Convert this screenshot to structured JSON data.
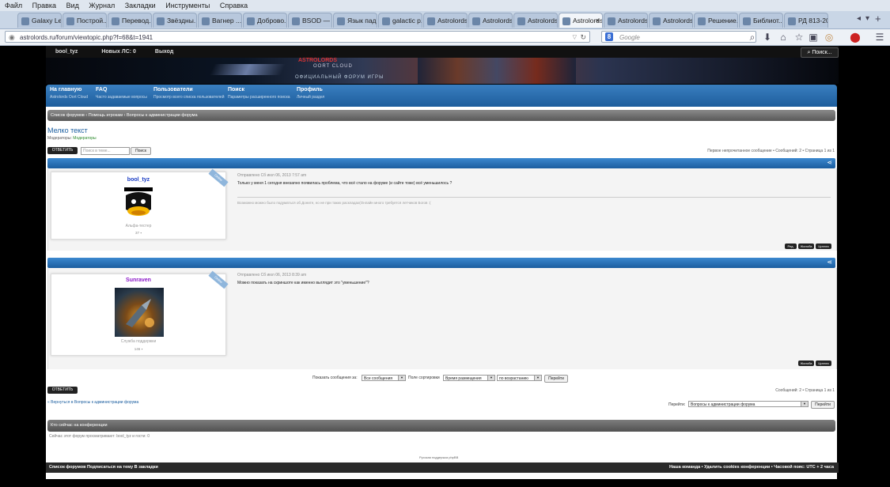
{
  "browser": {
    "menu": [
      "Файл",
      "Правка",
      "Вид",
      "Журнал",
      "Закладки",
      "Инструменты",
      "Справка"
    ],
    "tabs": [
      {
        "label": "Galaxy Le..."
      },
      {
        "label": "Построй..."
      },
      {
        "label": "Перевод..."
      },
      {
        "label": "Звёздны..."
      },
      {
        "label": "Вагнер ..."
      },
      {
        "label": "Доброво..."
      },
      {
        "label": "BSOD — ..."
      },
      {
        "label": "Язык пад..."
      },
      {
        "label": "galactic p..."
      },
      {
        "label": "Astrolords - C..."
      },
      {
        "label": "Astrolords Оо..."
      },
      {
        "label": "Astrolords Оо..."
      },
      {
        "label": "Astrolords Оо...",
        "active": true
      },
      {
        "label": "Astrolords Оо..."
      },
      {
        "label": "Astrolords Оо..."
      },
      {
        "label": "Решение..."
      },
      {
        "label": "Библиот..."
      },
      {
        "label": "РД 813-2013..."
      }
    ],
    "url": "astrolords.ru/forum/viewtopic.php?f=68&t=1941",
    "search_placeholder": "Google"
  },
  "forum": {
    "topbar": {
      "user": "bool_tyz",
      "messages": "Новых ЛС: 0",
      "logout": "Выход",
      "search": "Поиск..."
    },
    "banner": {
      "title": "ASTROLORDS",
      "sub1": "OORT CLOUD",
      "sub2": "ОФИЦИАЛЬНЫЙ ФОРУМ ИГРЫ"
    },
    "nav": [
      {
        "title": "На главную",
        "desc": "Astrolords Oort Cloud"
      },
      {
        "title": "FAQ",
        "desc": "Часто задаваемые вопросы"
      },
      {
        "title": "Пользователи",
        "desc": "Просмотр всего списка пользователей"
      },
      {
        "title": "Поиск",
        "desc": "Параметры расширенного поиска"
      },
      {
        "title": "Профиль",
        "desc": "Личный раздел"
      }
    ],
    "breadcrumb": "Список форумов ‹ Помощь игрокам ‹ Вопросы к администрации форума",
    "topic_title": "Мелко текст",
    "moderators_label": "Модераторы:",
    "moderators_value": "Модераторы",
    "reply_label": "ОТВЕТИТЬ",
    "search_topic_placeholder": "Поиск в теме...",
    "search_btn": "Поиск",
    "pagination_top": "Первое непрочитанное сообщение • Сообщений: 2 • Страница 1 из 1",
    "pagination_bottom": "Сообщений: 2 • Страница 1 из 1",
    "posts": [
      {
        "author": "bool_tyz",
        "author_color": "#1a3cc4",
        "rank": "Альфа-тестер",
        "posts_count": "37",
        "meta": "Отправлено Сб июл 06, 2013 7:57 am",
        "text": "Только у меня 1 сегодня внезапно появилась проблема, что всё стало на форуме (и сайте тоже) всё уменьшилось ?",
        "signature": "Возможно можно было подуматься об Доните, но не при таких раскладах(Онлайн много требуется летчиков Богов :(",
        "buttons": [
          "Ред.",
          "Жалоба",
          "Цитата"
        ],
        "badge": "Online"
      },
      {
        "author": "Sunraven",
        "author_color": "#8a16c8",
        "rank": "Служба поддержки",
        "posts_count": "146",
        "meta": "Отправлено Сб июл 06, 2013 8:39 am",
        "text": "Можно показать на скриншоте как именно выглядит это \"уменьшение\"?",
        "signature": "",
        "buttons": [
          "Жалоба",
          "Цитата"
        ],
        "badge": "Online"
      }
    ],
    "sort": {
      "show_label": "Показать сообщения за:",
      "show_value": "Все сообщения",
      "sort_label": "Поле сортировки",
      "sort_value": "Время размещения",
      "order_value": "по возрастанию",
      "go": "Перейти"
    },
    "back_link": "« Вернуться в Вопросы к администрации форума",
    "jump_label": "Перейти:",
    "jump_value": "Вопросы к администрации форума",
    "jump_go": "Перейти",
    "who_online_title": "Кто сейчас на конференции",
    "who_online_text": "Сейчас этот форум просматривают: bool_tyz и гости: 0",
    "footer_credit": "Русская поддержка phpBB",
    "bottom_left": "Список форумов  Подписаться на тему  В закладки",
    "bottom_right": "Наша команда • Удалить cookies конференции • Часовой пояс: UTC + 2 часа"
  }
}
